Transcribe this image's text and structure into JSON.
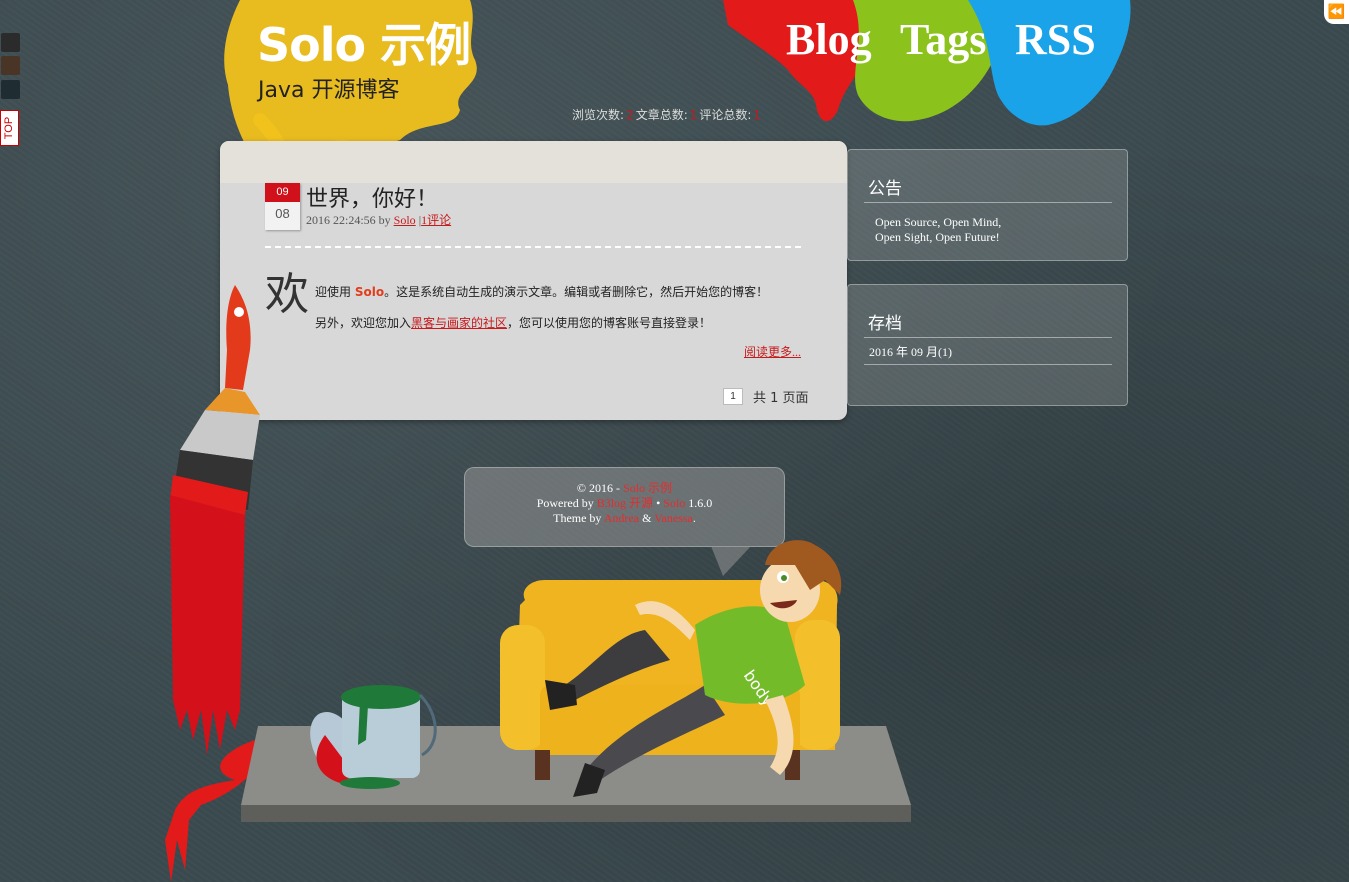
{
  "colors": {
    "accent_red": "#c8191b",
    "paint_yellow": "#f1c11c",
    "paint_red": "#e21a1a",
    "paint_green": "#8cc21c",
    "paint_blue": "#1aa3e8",
    "shirt_green": "#74bb2a"
  },
  "left_rail": {
    "swatches": [
      "#2b2b2b",
      "#4a3426",
      "#1f2d33"
    ],
    "top_label": "TOP"
  },
  "collapse_icon": "⏪",
  "header": {
    "title": "Solo 示例",
    "subtitle": "Java 开源博客",
    "nav": [
      "Blog",
      "Tags",
      "RSS"
    ],
    "stats": {
      "views_label": "浏览次数:",
      "views": "2",
      "articles_label": "文章总数:",
      "articles": "1",
      "comments_label": "评论总数:",
      "comments": "1"
    }
  },
  "post": {
    "month": "09",
    "day": "08",
    "title": "世界，你好！",
    "datetime": "2016 22:24:56",
    "by": "by",
    "author": "Solo",
    "sep": "|",
    "comments": "1评论",
    "dropcap": "欢",
    "p1_a": "迎使用 ",
    "p1_brand": "Solo",
    "p1_b": "。这是系统自动生成的演示文章。编辑或者删除它，然后开始您的博客！",
    "p2_a": "另外，欢迎您加入",
    "p2_link": "黑客与画家的社区",
    "p2_b": "，您可以使用您的博客账号直接登录！",
    "read_more": "阅读更多..."
  },
  "pager": {
    "current": "1",
    "total_text": "共 1 页面"
  },
  "sidebar": {
    "notice_title": "公告",
    "notice_line1": "Open Source, Open Mind,",
    "notice_line2": "Open Sight, Open Future!",
    "archive_title": "存档",
    "archive_item": "2016 年 09 月(1)"
  },
  "footer": {
    "copyright": "© 2016 - ",
    "site": "Solo 示例",
    "powered_by": "Powered by ",
    "b3log": "B3log 开源",
    "bullet": " • ",
    "solo": "Solo",
    "version": " 1.6.0",
    "theme_by": "Theme by ",
    "andrea": "Andrea",
    "amp": " & ",
    "vanessa": "Vanessa",
    "dot": "."
  },
  "illustration": {
    "shirt_text": "body"
  }
}
